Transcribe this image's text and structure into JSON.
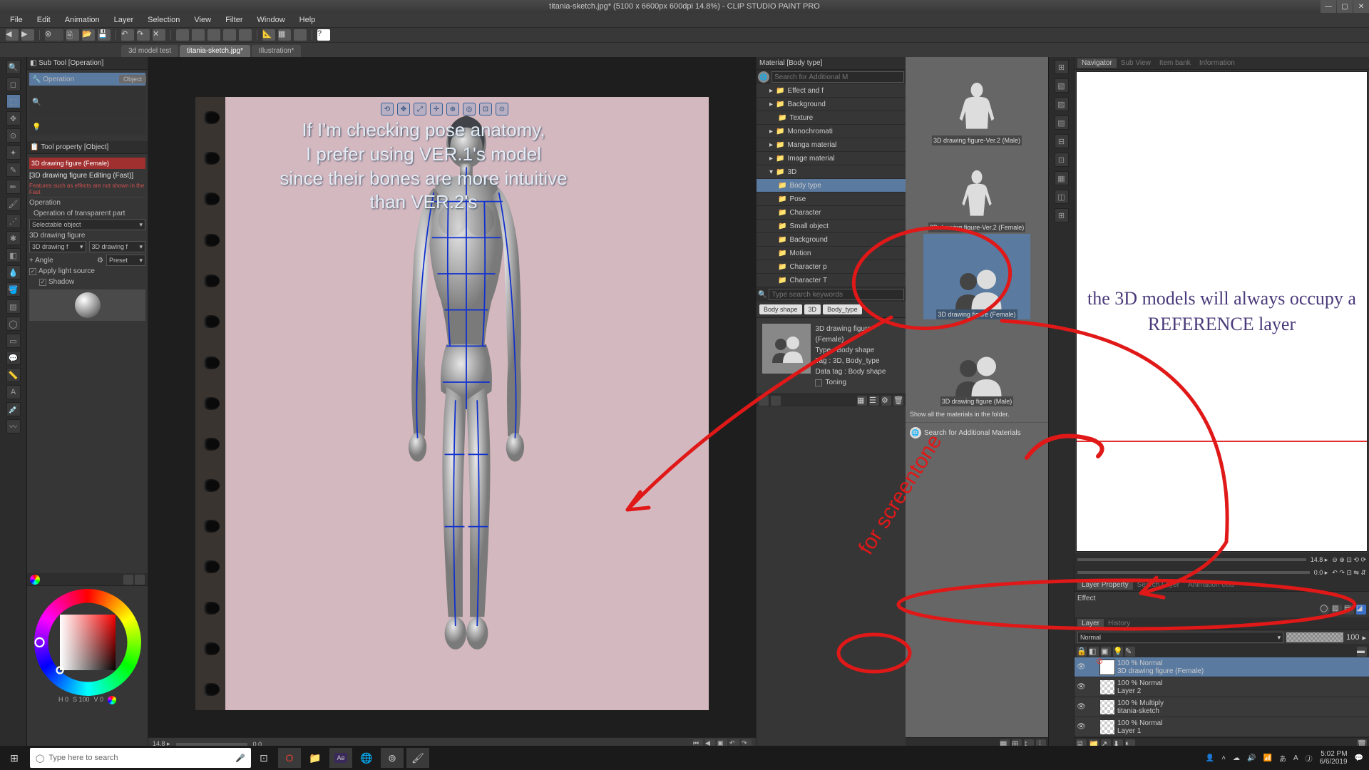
{
  "title": "titania-sketch.jpg* (5100 x 6600px 600dpi 14.8%) - CLIP STUDIO PAINT PRO",
  "menus": [
    "File",
    "Edit",
    "Animation",
    "Layer",
    "Selection",
    "View",
    "Filter",
    "Window",
    "Help"
  ],
  "tabs": [
    {
      "label": "3d model test",
      "active": false
    },
    {
      "label": "titania-sketch.jpg*",
      "active": true
    },
    {
      "label": "Illustration*",
      "active": false
    }
  ],
  "subtool": {
    "header": "Sub Tool [Operation]",
    "row": "Operation",
    "object": "Object"
  },
  "toolprop": {
    "header": "Tool property [Object]",
    "obj_title": "3D drawing figure (Female)",
    "edit_mode": "[3D drawing figure Editing (Fast)]",
    "warning": "Features such as effects are not shown in the Fast",
    "section": "Operation",
    "transparent": "Operation of transparent part",
    "selectable": "Selectable object",
    "figure_label": "3D drawing figure",
    "figure_opt1": "3D drawing f",
    "figure_opt2": "3D drawing f",
    "angle": "+ Angle",
    "preset": "Preset",
    "apply_light": "Apply light source",
    "shadow": "Shadow"
  },
  "material": {
    "header": "Material [Body type]",
    "search_placeholder": "Search for Additional M",
    "tree": [
      {
        "label": "Effect and f",
        "indent": 1
      },
      {
        "label": "Background",
        "indent": 1
      },
      {
        "label": "Texture",
        "indent": 2
      },
      {
        "label": "Monochromati",
        "indent": 1
      },
      {
        "label": "Manga material",
        "indent": 1
      },
      {
        "label": "Image material",
        "indent": 1
      },
      {
        "label": "3D",
        "indent": 1,
        "expanded": true
      },
      {
        "label": "Body type",
        "indent": 2,
        "selected": true
      },
      {
        "label": "Pose",
        "indent": 2
      },
      {
        "label": "Character",
        "indent": 2
      },
      {
        "label": "Small object",
        "indent": 2
      },
      {
        "label": "Background",
        "indent": 2
      },
      {
        "label": "Motion",
        "indent": 2
      },
      {
        "label": "Character p",
        "indent": 2
      },
      {
        "label": "Character T",
        "indent": 2
      }
    ],
    "keyword_placeholder": "Type search keywords",
    "tags": [
      "Body shape",
      "3D",
      "Body_type"
    ],
    "grid": [
      {
        "label": "3D drawing figure-Ver.2 (Male)",
        "sel": false
      },
      {
        "label": "3D drawing figure-Ver.2 (Female)",
        "sel": false
      },
      {
        "label": "3D drawing figure (Female)",
        "sel": true
      },
      {
        "label": "3D drawing figure (Male)",
        "sel": false
      }
    ],
    "show_all": "Show all the materials in the folder.",
    "search_add": "Search for Additional Materials",
    "info": {
      "name": "3D drawing figure (Female)",
      "type": "Type :  Body shape",
      "tag": "Tag :  3D, Body_type",
      "data": "Data tag :  Body shape",
      "toning": "Toning"
    }
  },
  "navigator": {
    "header_tabs": [
      "Navigator",
      "Sub View",
      "Item bank",
      "Information"
    ],
    "anno": "the 3D models will always occupy a REFERENCE layer",
    "zoom": "14.8",
    "rot": "0.0"
  },
  "layerprop": {
    "header_tabs": [
      "Layer Property",
      "Search Layer",
      "Animation cels"
    ],
    "section": "Effect"
  },
  "layer": {
    "header_tabs": [
      "Layer",
      "History"
    ],
    "blend": "Normal",
    "opacity": "100",
    "layers": [
      {
        "mode": "100 % Normal",
        "name": "3D drawing figure (Female)",
        "sel": true,
        "ref": true
      },
      {
        "mode": "100 % Normal",
        "name": "Layer 2",
        "sel": false
      },
      {
        "mode": "100 % Multiply",
        "name": "titania-sketch",
        "sel": false
      },
      {
        "mode": "100 % Normal",
        "name": "Layer 1",
        "sel": false
      }
    ]
  },
  "canvas_overlay": "If I'm checking pose anatomy,\nI prefer using VER.1's model\nsince their bones are more intuitive\nthan VER.2's",
  "canvas_zoom": "14.8",
  "canvas_rot": "0.0",
  "hsl": {
    "H": "0",
    "S": "100",
    "V": "0"
  },
  "taskbar": {
    "search_placeholder": "Type here to search",
    "time": "5:02 PM",
    "date": "6/6/2019"
  }
}
